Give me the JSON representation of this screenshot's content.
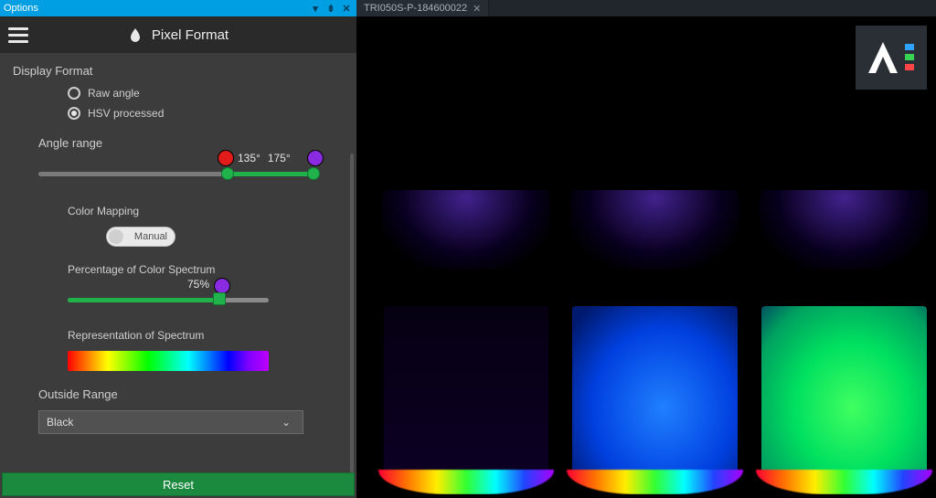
{
  "options_panel": {
    "titlebar_label": "Options",
    "header_title": "Pixel Format",
    "display_format": {
      "label": "Display Format",
      "raw_angle_label": "Raw angle",
      "hsv_label": "HSV processed",
      "selected": "hsv"
    },
    "angle_range": {
      "label": "Angle range",
      "low_display": "135°",
      "high_display": "175°",
      "low_value": 135,
      "high_value": 175
    },
    "color_mapping": {
      "label": "Color Mapping",
      "mode_label": "Manual"
    },
    "percent_spectrum": {
      "label": "Percentage of Color Spectrum",
      "value_display": "75%",
      "value": 75
    },
    "representation": {
      "label": "Representation of Spectrum"
    },
    "outside_range": {
      "label": "Outside Range",
      "selected": "Black"
    },
    "reset_label": "Reset"
  },
  "viewer": {
    "tab_label": "TRI050S-P-184600022"
  },
  "logo": {
    "brand": "AE",
    "bar_colors": [
      "#2ea3ff",
      "#39d353",
      "#ff4545"
    ]
  }
}
